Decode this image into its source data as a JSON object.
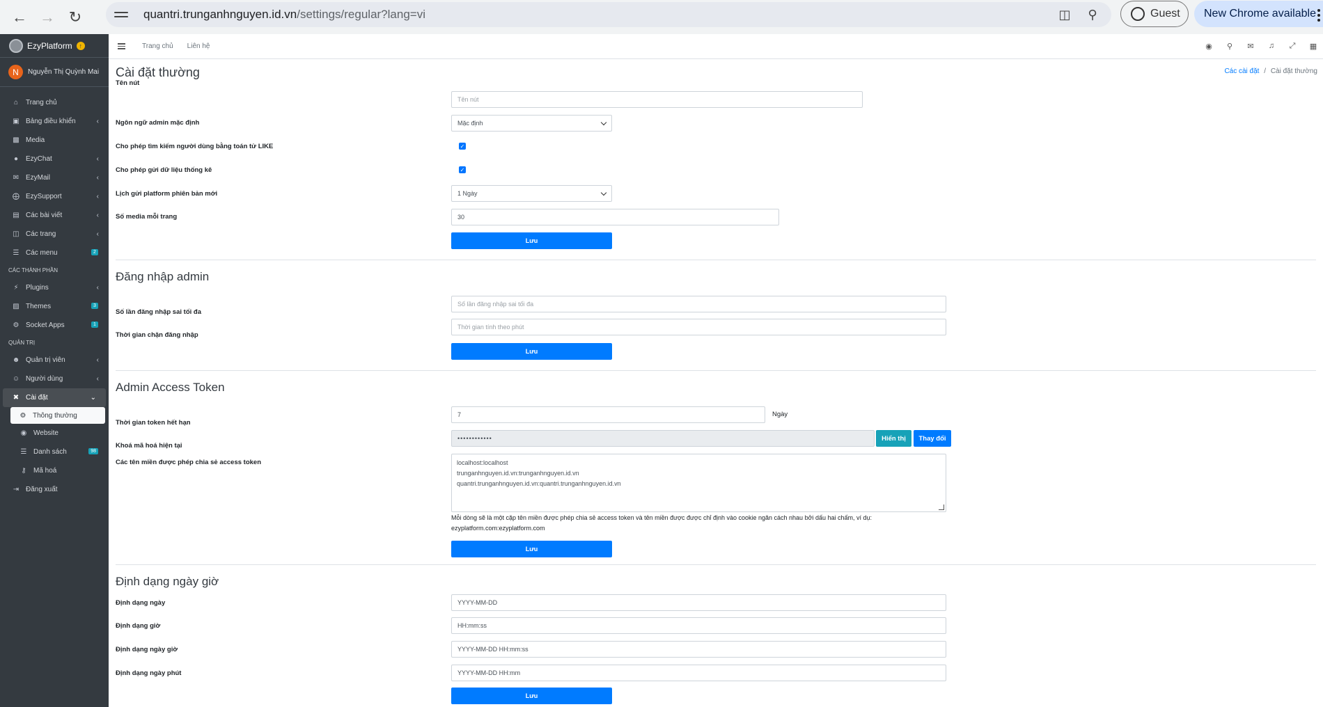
{
  "browser": {
    "url_host": "quantri.trunganhnguyen.id.vn",
    "url_path": "/settings/regular?lang=vi",
    "guest_label": "Guest",
    "update_label": "New Chrome available"
  },
  "sidebar": {
    "brand": "EzyPlatform",
    "user_initial": "N",
    "user_name": "Nguyễn Thị Quỳnh Mai",
    "items": [
      {
        "label": "Trang chủ"
      },
      {
        "label": "Bảng điều khiển"
      },
      {
        "label": "Media"
      },
      {
        "label": "EzyChat"
      },
      {
        "label": "EzyMail"
      },
      {
        "label": "EzySupport"
      },
      {
        "label": "Các bài viết"
      },
      {
        "label": "Các trang"
      },
      {
        "label": "Các menu",
        "badge": "2"
      }
    ],
    "section_components": "CÁC THÀNH PHẦN",
    "components": [
      {
        "label": "Plugins"
      },
      {
        "label": "Themes",
        "badge": "3"
      },
      {
        "label": "Socket Apps",
        "badge": "1"
      }
    ],
    "section_admin": "QUẢN TRỊ",
    "admin": [
      {
        "label": "Quản trị viên"
      },
      {
        "label": "Người dùng"
      },
      {
        "label": "Cài đặt"
      }
    ],
    "settings_sub": [
      {
        "label": "Thông thường"
      },
      {
        "label": "Website"
      },
      {
        "label": "Danh sách",
        "badge": "98"
      },
      {
        "label": "Mã hoá"
      }
    ],
    "logout": "Đăng xuất"
  },
  "topbar": {
    "home": "Trang chủ",
    "contact": "Liên hệ"
  },
  "breadcrumb": {
    "parent": "Các cài đặt",
    "sep": "/",
    "current": "Cài đặt thường"
  },
  "regular": {
    "title": "Cài đặt thường",
    "button_name_label": "Tên nút",
    "button_name_placeholder": "Tên nút",
    "default_lang_label": "Ngôn ngữ admin mặc định",
    "default_lang_value": "Mặc định",
    "like_search_label": "Cho phép tìm kiếm người dùng bằng toán tử LIKE",
    "stats_label": "Cho phép gửi dữ liệu thống kê",
    "schedule_label": "Lịch gửi platform phiên bản mới",
    "schedule_value": "1 Ngày",
    "media_per_page_label": "Số media mỗi trang",
    "media_per_page_value": "30",
    "save": "Lưu"
  },
  "login": {
    "title": "Đăng nhập admin",
    "max_fail_label": "Số lần đăng nhập sai tối đa",
    "max_fail_placeholder": "Số lần đăng nhập sai tối đa",
    "block_time_label": "Thời gian chặn đăng nhập",
    "block_time_placeholder": "Thời gian tính theo phút",
    "save": "Lưu"
  },
  "token": {
    "title": "Admin Access Token",
    "expire_label": "Thời gian token hết hạn",
    "expire_value": "7",
    "expire_unit": "Ngày",
    "key_label": "Khoá mã hoá hiện tại",
    "key_value": "••••••••••••",
    "show_button": "Hiển thị",
    "change_button": "Thay đổi",
    "domains_label": "Các tên miền được phép chia sẻ access token",
    "domains": [
      "localhost:localhost",
      "trunganhnguyen.id.vn:trunganhnguyen.id.vn",
      "quantri.trunganhnguyen.id.vn:quantri.trunganhnguyen.id.vn"
    ],
    "help_line1": "Mỗi dòng sẽ là một cặp tên miền được phép chia sẻ access token và tên miền được được chỉ định vào cookie ngăn cách nhau bởi dấu hai chấm, ví dụ:",
    "help_line2": "ezyplatform.com:ezyplatform.com",
    "save": "Lưu"
  },
  "datetime": {
    "title": "Định dạng ngày giờ",
    "date_label": "Định dạng ngày",
    "date_value": "YYYY-MM-DD",
    "time_label": "Định dạng giờ",
    "time_value": "HH:mm:ss",
    "datetime_label": "Định dạng ngày giờ",
    "datetime_value": "YYYY-MM-DD HH:mm:ss",
    "dateminute_label": "Định dạng ngày phút",
    "dateminute_value": "YYYY-MM-DD HH:mm",
    "save": "Lưu"
  },
  "colors": {
    "primary": "#007bff",
    "info": "#17a2b8",
    "sidebar": "#343a40"
  }
}
